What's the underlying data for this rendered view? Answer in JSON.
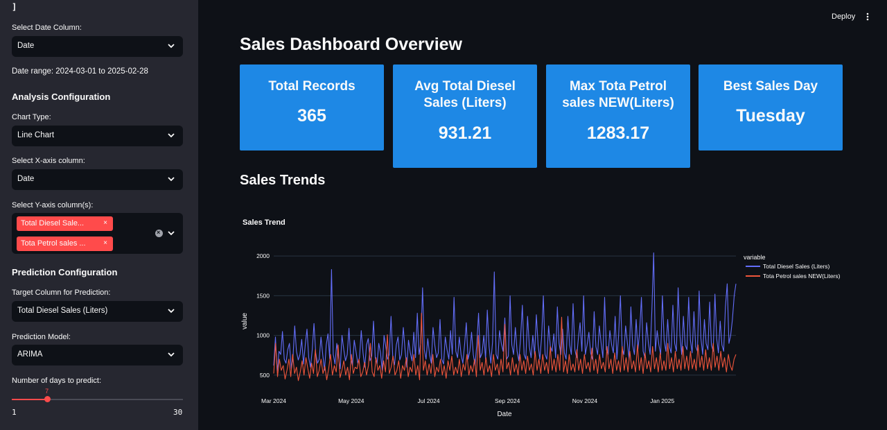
{
  "sidebar": {
    "close_glyph": "]",
    "date_column_label": "Select Date Column:",
    "date_column_value": "Date",
    "date_range_text": "Date range: 2024-03-01 to 2025-02-28",
    "analysis_heading": "Analysis Configuration",
    "chart_type_label": "Chart Type:",
    "chart_type_value": "Line Chart",
    "x_axis_label": "Select X-axis column:",
    "x_axis_value": "Date",
    "y_axis_label": "Select Y-axis column(s):",
    "y_axis_tags": [
      "Total Diesel Sale...",
      "Tota Petrol sales ..."
    ],
    "tag_remove_glyph": "×",
    "prediction_heading": "Prediction Configuration",
    "target_label": "Target Column for Prediction:",
    "target_value": "Total Diesel Sales (Liters)",
    "model_label": "Prediction Model:",
    "model_value": "ARIMA",
    "days_label": "Number of days to predict:",
    "days_value": "7",
    "days_min": "1",
    "days_max": "30",
    "days_fraction": 0.2069
  },
  "toolbar": {
    "deploy_label": "Deploy",
    "menu_icon": "vertical-dots-icon"
  },
  "main": {
    "title": "Sales Dashboard Overview",
    "metrics": [
      {
        "title": "Total Records",
        "value": "365"
      },
      {
        "title": "Avg Total Diesel Sales (Liters)",
        "value": "931.21"
      },
      {
        "title": "Max Tota Petrol sales NEW(Liters)",
        "value": "1283.17"
      },
      {
        "title": "Best Sales Day",
        "value": "Tuesday"
      }
    ],
    "trends_heading": "Sales Trends"
  },
  "colors": {
    "accent": "#ff4b4b",
    "card": "#1e88e5",
    "diesel": "#636efa",
    "petrol": "#ef553b"
  },
  "chart_data": {
    "type": "line",
    "title": "Sales Trend",
    "xlabel": "Date",
    "ylabel": "value",
    "legend_title": "variable",
    "legend_position": "top-right",
    "x_start": "2024-03-01",
    "x_end": "2025-02-28",
    "x_ticks": [
      "Mar 2024",
      "May 2024",
      "Jul 2024",
      "Sep 2024",
      "Nov 2024",
      "Jan 2025"
    ],
    "y_ticks": [
      500,
      1000,
      1500,
      2000
    ],
    "ylim": [
      350,
      2080
    ],
    "grid": true,
    "series": [
      {
        "name": "Total Diesel Sales (Liters)",
        "color": "#636efa",
        "values": [
          620,
          980,
          540,
          800,
          760,
          1050,
          700,
          650,
          820,
          900,
          580,
          720,
          1120,
          800,
          690,
          760,
          950,
          640,
          880,
          1080,
          720,
          600,
          820,
          1150,
          780,
          650,
          700,
          980,
          760,
          560,
          880,
          1020,
          700,
          1830,
          760,
          640,
          900,
          720,
          580,
          1000,
          820,
          680,
          760,
          1090,
          700,
          620,
          940,
          800,
          650,
          720,
          1060,
          780,
          600,
          880,
          960,
          680,
          740,
          1180,
          720,
          640,
          900,
          780,
          560,
          1000,
          860,
          700,
          760,
          1240,
          720,
          630,
          880,
          980,
          690,
          760,
          1100,
          820,
          600,
          940,
          780,
          680,
          1040,
          720,
          1280,
          760,
          900,
          1600,
          820,
          700,
          960,
          760,
          650,
          1100,
          880,
          720,
          780,
          1200,
          700,
          640,
          980,
          820,
          700,
          1060,
          760,
          1480,
          800,
          720,
          980,
          760,
          650,
          880,
          1160,
          700,
          800,
          1040,
          760,
          620,
          900,
          1280,
          720,
          780,
          1000,
          700,
          1320,
          860,
          650,
          920,
          1800,
          760,
          700,
          1060,
          900,
          800,
          1220,
          700,
          740,
          1500,
          880,
          760,
          1100,
          800,
          680,
          960,
          1380,
          760,
          700,
          1240,
          860,
          720,
          1000,
          760,
          1260,
          880,
          700,
          980,
          1500,
          760,
          700,
          1120,
          860,
          800,
          1020,
          720,
          1360,
          900,
          760,
          1080,
          780,
          700,
          1240,
          880,
          760,
          1400,
          820,
          720,
          960,
          1160,
          800,
          1500,
          760,
          880,
          1040,
          780,
          700,
          1300,
          860,
          760,
          1120,
          900,
          720,
          1480,
          820,
          760,
          1060,
          880,
          780,
          1240,
          700,
          1000,
          1500,
          840,
          760,
          1120,
          900,
          700,
          1360,
          880,
          760,
          1200,
          820,
          1040,
          1480,
          800,
          720,
          1160,
          900,
          760,
          1320,
          2040,
          800,
          1060,
          880,
          760,
          1500,
          940,
          800,
          1200,
          860,
          780,
          1380,
          900,
          800,
          1600,
          1000,
          760,
          1240,
          880,
          820,
          1480,
          940,
          780,
          1300,
          860,
          800,
          1560,
          960,
          760,
          1200,
          900,
          820,
          1420,
          880,
          800,
          1520,
          960,
          780,
          1180,
          880,
          800,
          1360,
          1650,
          900,
          1000,
          1200,
          1500,
          1650
        ]
      },
      {
        "name": "Tota Petrol sales  NEW(Liters)",
        "color": "#ef553b",
        "values": [
          520,
          900,
          480,
          700,
          560,
          620,
          450,
          560,
          700,
          480,
          760,
          520,
          600,
          430,
          540,
          680,
          500,
          720,
          580,
          460,
          650,
          520,
          820,
          480,
          560,
          700,
          520,
          610,
          440,
          580,
          760,
          500,
          620,
          540,
          880,
          470,
          560,
          680,
          500,
          600,
          440,
          760,
          520,
          600,
          580,
          700,
          480,
          540,
          660,
          500,
          620,
          900,
          540,
          480,
          720,
          560,
          620,
          460,
          680,
          540,
          1010,
          520,
          600,
          740,
          500,
          560,
          680,
          460,
          620,
          560,
          720,
          480,
          600,
          540,
          760,
          500,
          620,
          440,
          1280,
          560,
          680,
          500,
          640,
          520,
          760,
          480,
          600,
          540,
          700,
          500,
          620,
          460,
          680,
          560,
          740,
          500,
          600,
          520,
          700,
          480,
          640,
          560,
          760,
          500,
          620,
          540,
          700,
          480,
          1000,
          560,
          660,
          500,
          720,
          540,
          620,
          480,
          760,
          560,
          640,
          500,
          700,
          540,
          1140,
          580,
          660,
          500,
          720,
          540,
          640,
          500,
          760,
          560,
          680,
          520,
          740,
          560,
          640,
          500,
          800,
          560,
          700,
          520,
          760,
          560,
          660,
          520,
          860,
          560,
          700,
          540,
          760,
          560,
          1230,
          540,
          680,
          520,
          760,
          560,
          640,
          540,
          820,
          560,
          700,
          520,
          760,
          580,
          660,
          540,
          840,
          560,
          700,
          520,
          760,
          580,
          660,
          540,
          860,
          580,
          700,
          520,
          780,
          560,
          680,
          540,
          860,
          560,
          720,
          540,
          800,
          580,
          680,
          540,
          880,
          560,
          720,
          520,
          780,
          580,
          680,
          540,
          860,
          580,
          720,
          540,
          780,
          560,
          680,
          560,
          900,
          580,
          720,
          540,
          800,
          580,
          700,
          560,
          860,
          580,
          740,
          560,
          800,
          580,
          700,
          560,
          880,
          600,
          740,
          560,
          820,
          580,
          720,
          560,
          900,
          600,
          740,
          560,
          800,
          600,
          720,
          540,
          760,
          620,
          560,
          700,
          760
        ]
      }
    ]
  }
}
